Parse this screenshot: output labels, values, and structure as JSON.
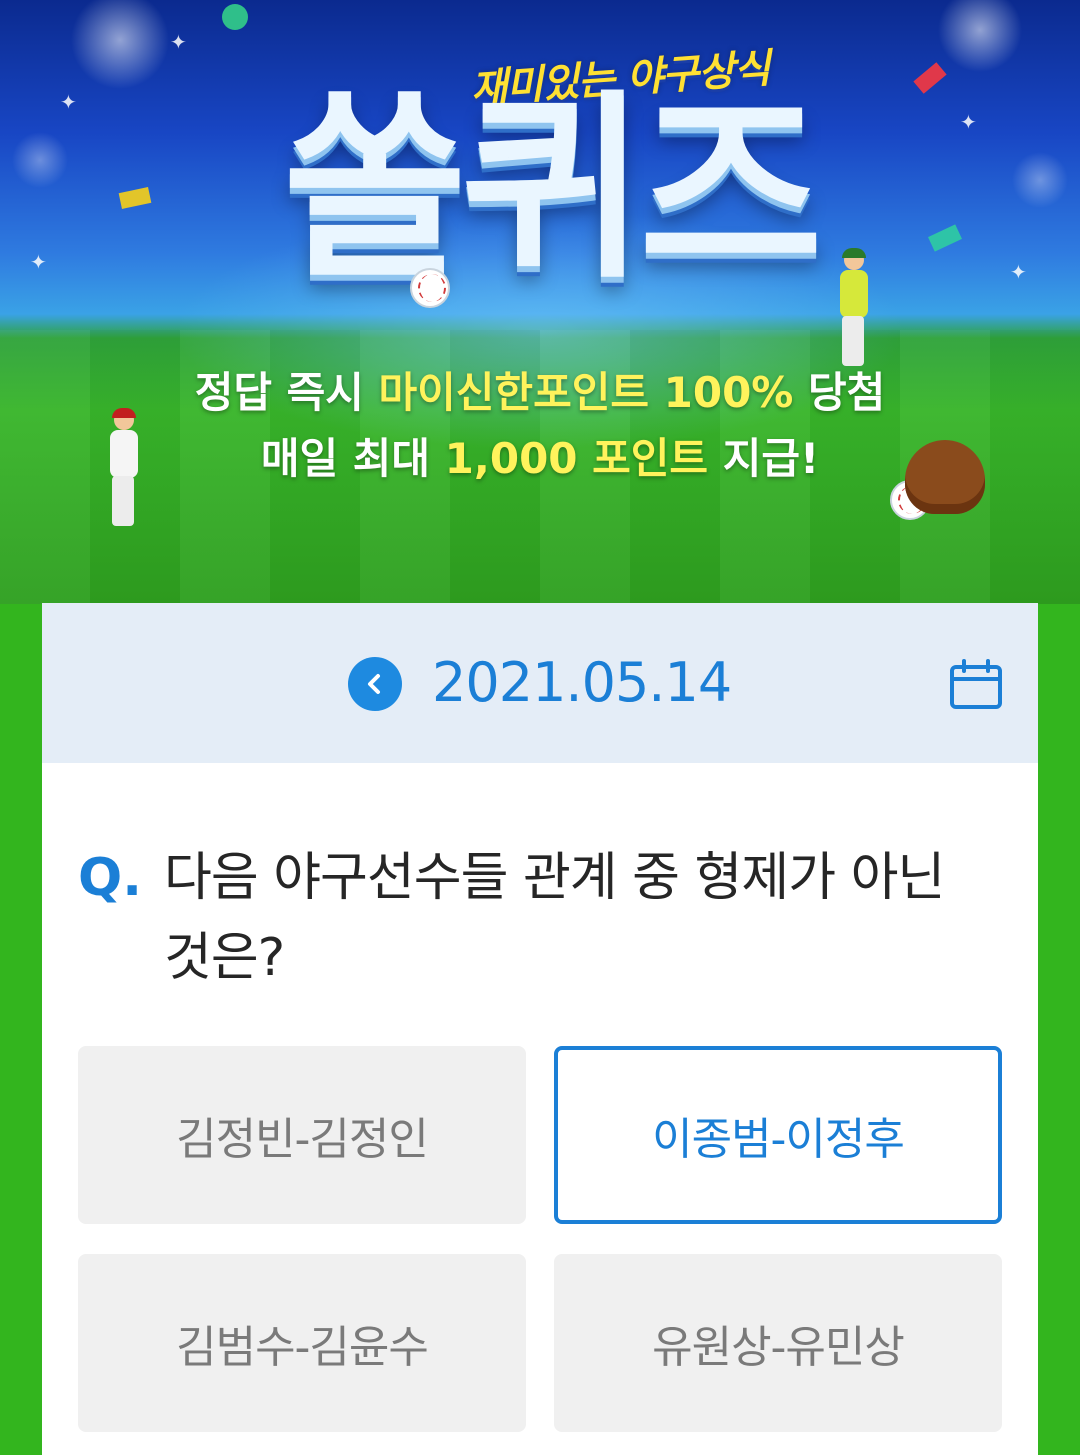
{
  "banner": {
    "subtitle": "재미있는 야구상식",
    "title": "쏠퀴즈",
    "line1_a": "정답 즉시 ",
    "line1_highlight": "마이신한포인트 100%",
    "line1_b": " 당첨",
    "line2_a": "매일 최대 ",
    "line2_highlight": "1,000 포인트",
    "line2_b": " 지급!"
  },
  "date_nav": {
    "date": "2021.05.14",
    "prev_icon": "chevron-left-icon",
    "calendar_icon": "calendar-icon"
  },
  "quiz": {
    "q_mark": "Q.",
    "question": "다음 야구선수들 관계 중 형제가 아닌 것은?",
    "options": [
      {
        "label": "김정빈-김정인",
        "selected": false
      },
      {
        "label": "이종범-이정후",
        "selected": true
      },
      {
        "label": "김범수-김윤수",
        "selected": false
      },
      {
        "label": "유원상-유민상",
        "selected": false
      }
    ]
  },
  "colors": {
    "accent": "#1b7fd6",
    "page_bg": "#33b51e",
    "date_bar": "#e4edf7",
    "highlight_text": "#fff35c"
  }
}
